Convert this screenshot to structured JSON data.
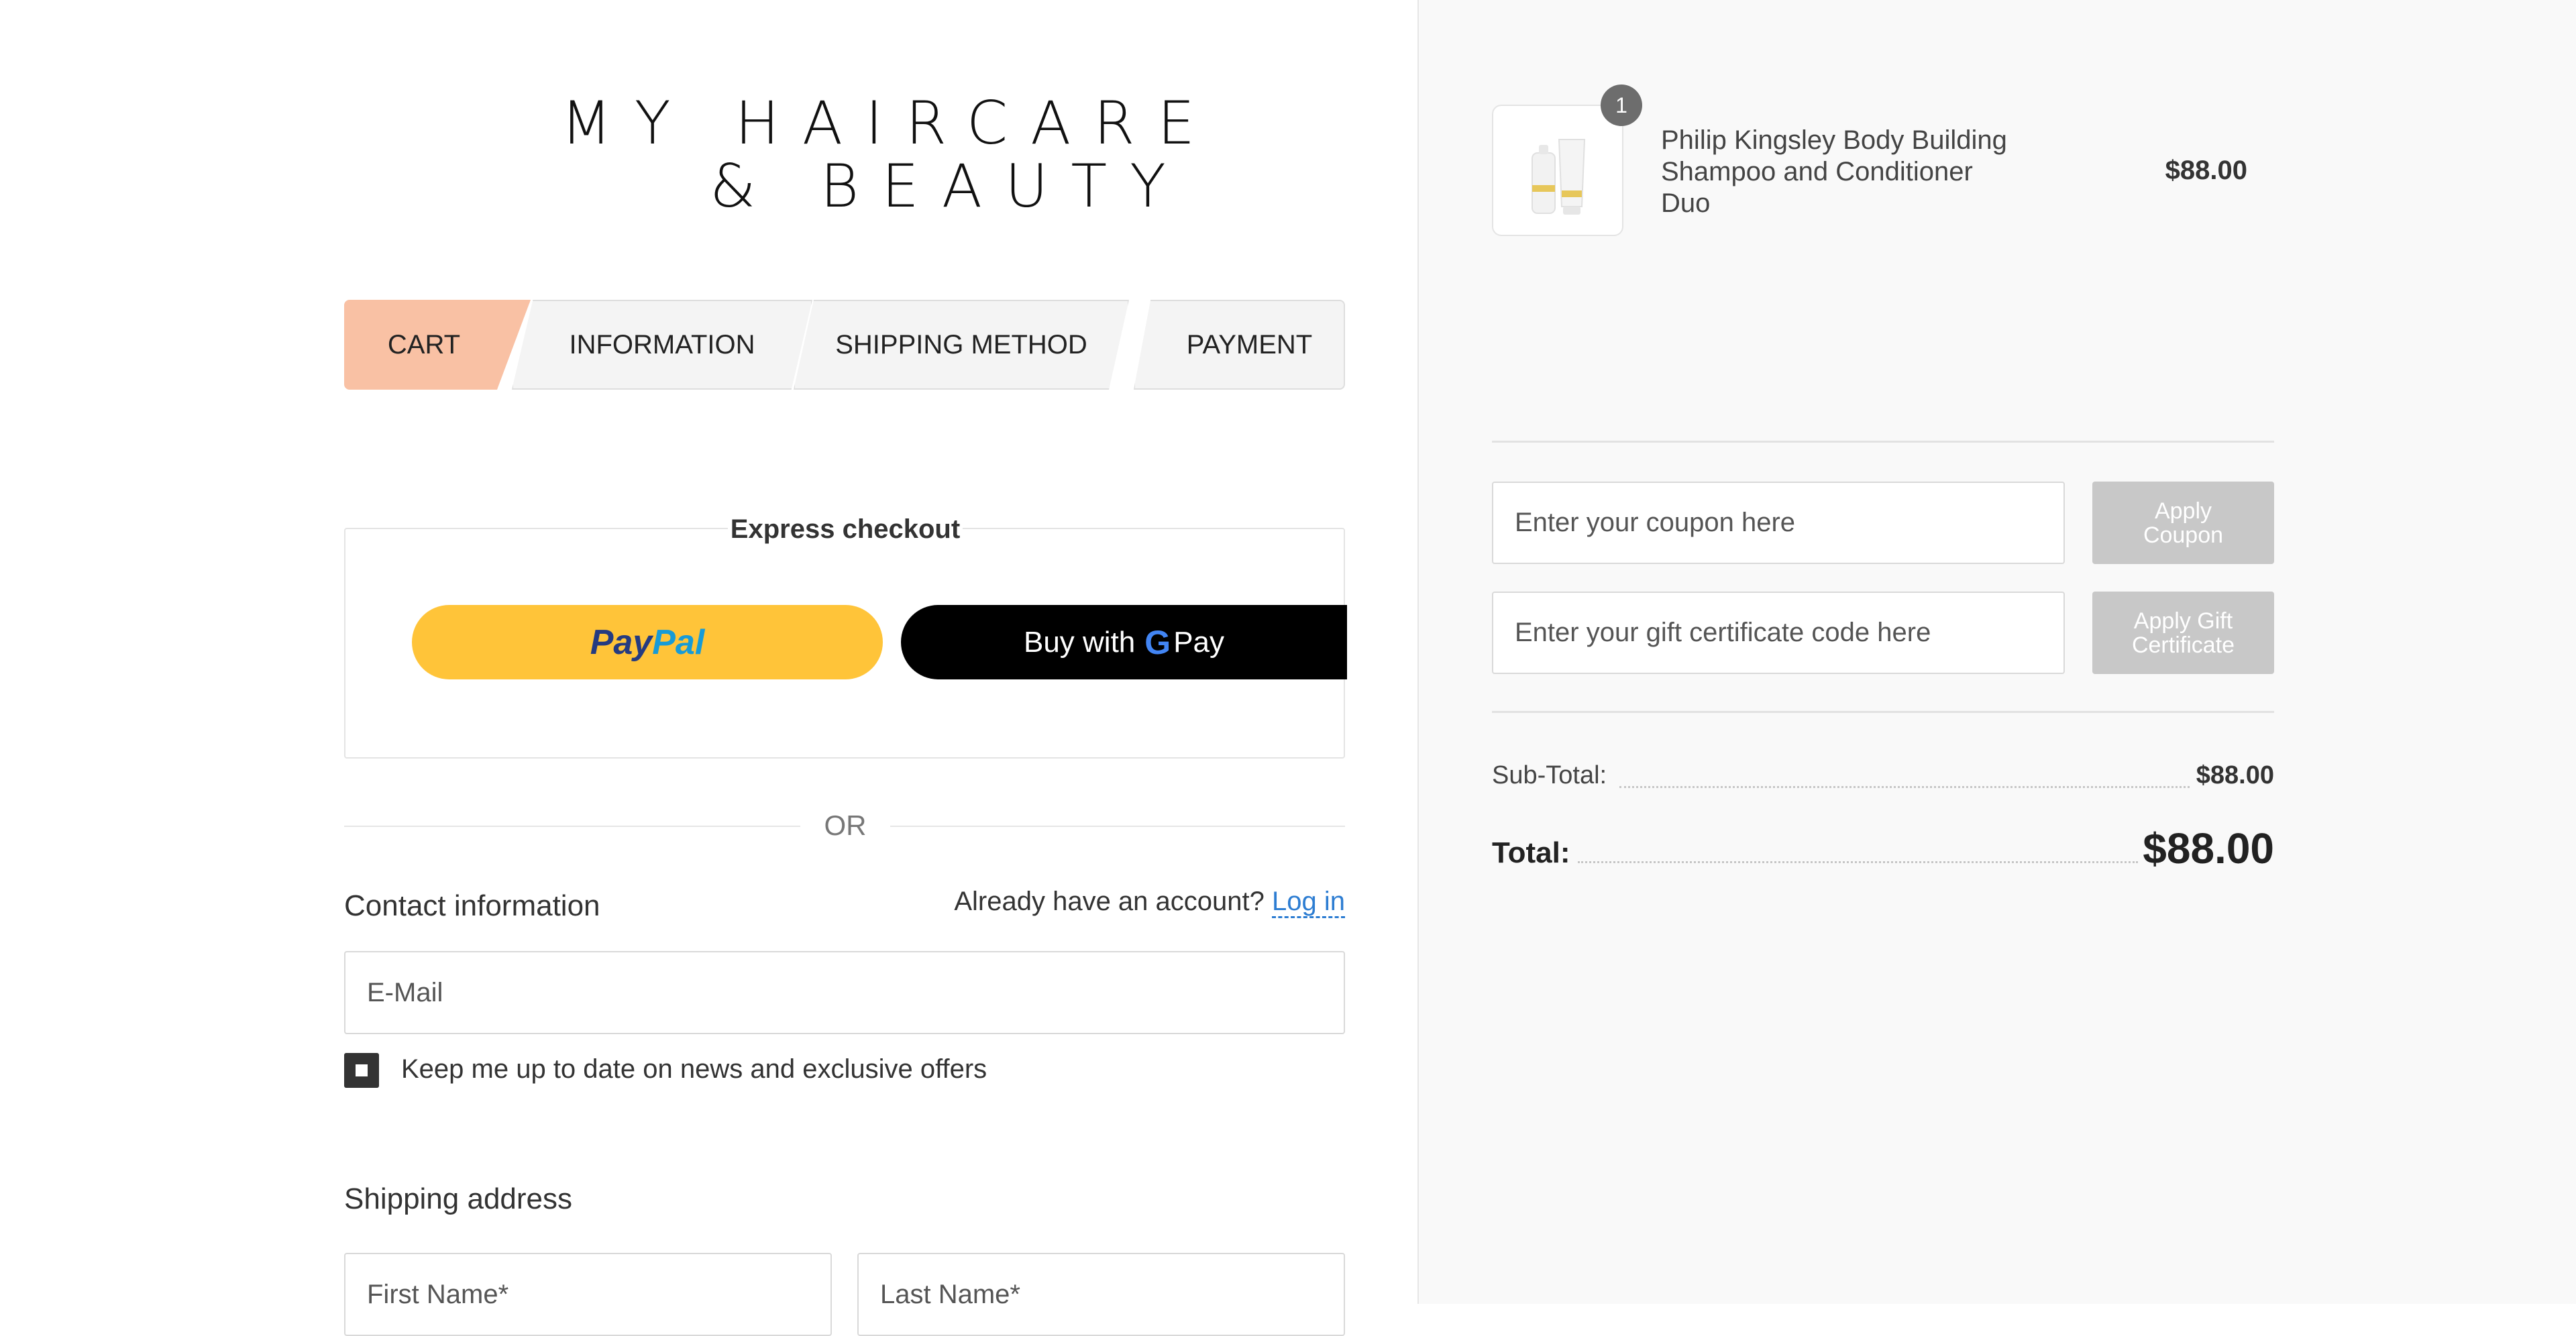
{
  "logo": {
    "line1": "MY HAIRCARE",
    "line2": "& BEAUTY"
  },
  "steps": [
    {
      "label": "CART",
      "active": true
    },
    {
      "label": "INFORMATION",
      "active": false
    },
    {
      "label": "SHIPPING METHOD",
      "active": false
    },
    {
      "label": "PAYMENT",
      "active": false
    }
  ],
  "express": {
    "title": "Express checkout",
    "paypal_pay": "Pay",
    "paypal_pal": "Pal",
    "gpay_prefix": "Buy with",
    "gpay_g": "G",
    "gpay_suffix": "Pay"
  },
  "or_label": "OR",
  "contact": {
    "title": "Contact information",
    "account_prompt": "Already have an account?",
    "login_label": "Log in",
    "email_placeholder": "E-Mail",
    "newsletter_label": "Keep me up to date on news and exclusive offers",
    "newsletter_checked": true
  },
  "shipping": {
    "title": "Shipping address",
    "first_name_placeholder": "First Name*",
    "last_name_placeholder": "Last Name*"
  },
  "cart": {
    "item": {
      "name_line1": "Philip Kingsley Body Building",
      "name_line2": "Shampoo and Conditioner",
      "name_line3": "Duo",
      "price": "$88.00",
      "quantity": "1"
    },
    "coupon_placeholder": "Enter your coupon here",
    "apply_coupon_line1": "Apply",
    "apply_coupon_line2": "Coupon",
    "gift_placeholder": "Enter your gift certificate code here",
    "apply_gift_line1": "Apply Gift",
    "apply_gift_line2": "Certificate",
    "subtotal_label": "Sub-Total:",
    "subtotal_value": "$88.00",
    "total_label": "Total:",
    "total_value": "$88.00"
  },
  "colors": {
    "active_step": "#f9c1a4",
    "paypal_yellow": "#ffc439",
    "link_blue": "#2d7dd2",
    "summary_bg": "#f9f9f9"
  }
}
